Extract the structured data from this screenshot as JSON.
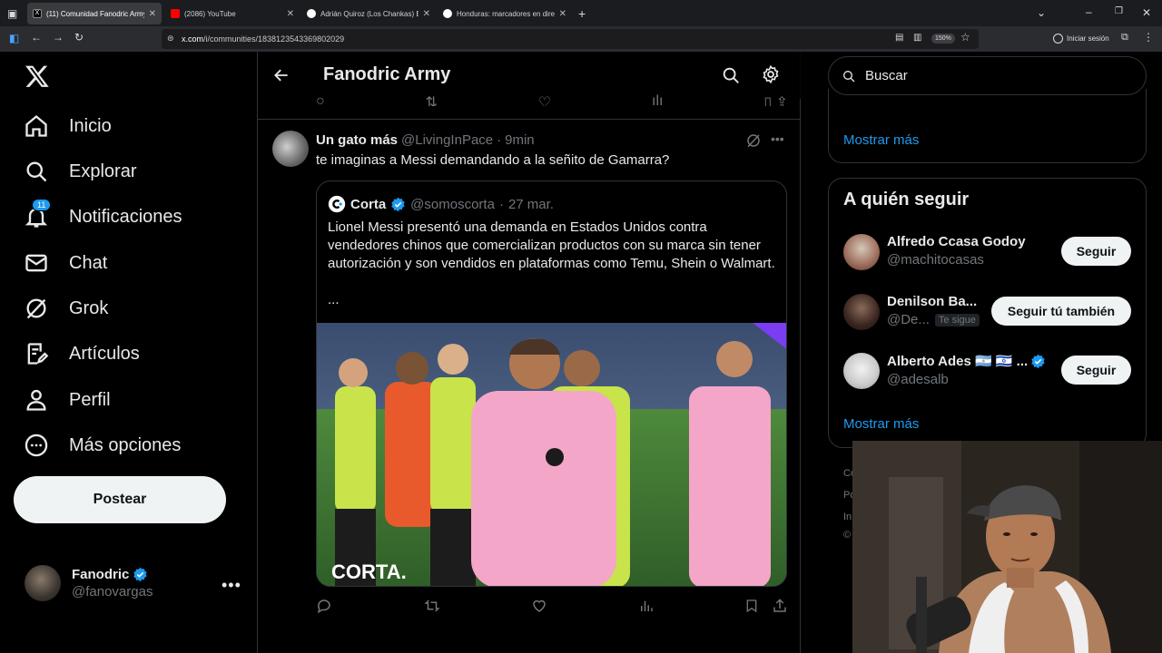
{
  "browser": {
    "tabs": [
      {
        "title": "(11) Comunidad Fanodric Army",
        "active": true
      },
      {
        "title": "(2086) YouTube",
        "active": false
      },
      {
        "title": "Adrián Quiroz (Los Chankas) Est",
        "active": false
      },
      {
        "title": "Honduras: marcadores en direc",
        "active": false
      }
    ],
    "url_host": "x.com",
    "url_path": "/i/communities/1838123543369802029",
    "zoom": "150%",
    "signin": "Iniciar sesión"
  },
  "nav": {
    "items": [
      {
        "label": "Inicio",
        "icon": "home-icon"
      },
      {
        "label": "Explorar",
        "icon": "search-icon"
      },
      {
        "label": "Notificaciones",
        "icon": "bell-icon",
        "badge": "11"
      },
      {
        "label": "Chat",
        "icon": "mail-icon"
      },
      {
        "label": "Grok",
        "icon": "grok-icon"
      },
      {
        "label": "Artículos",
        "icon": "article-icon"
      },
      {
        "label": "Perfil",
        "icon": "person-icon"
      },
      {
        "label": "Más opciones",
        "icon": "more-circle-icon"
      }
    ],
    "post_label": "Postear"
  },
  "account": {
    "name": "Fanodric",
    "handle": "@fanovargas"
  },
  "header": {
    "title": "Fanodric Army"
  },
  "tweet": {
    "name": "Un gato más",
    "handle": "@LivingInPace",
    "time": "9min",
    "text": "te imaginas a Messi demandando a la señito de Gamarra?",
    "quote": {
      "name": "Corta",
      "handle": "@somoscorta",
      "date": "27 mar.",
      "text": "Lionel Messi presentó una demanda en Estados Unidos contra vendedores chinos que comercializan productos con su marca sin tener autorización y son vendidos en plataformas como Temu, Shein o Walmart.",
      "more": "...",
      "watermark": "CORTA."
    }
  },
  "right": {
    "search_placeholder": "Buscar",
    "show_more": "Mostrar más",
    "who_to_follow": "A quién seguir",
    "suggestions": [
      {
        "name": "Alfredo Ccasa Godoy",
        "handle": "@machitocasas",
        "button": "Seguir"
      },
      {
        "name": "Denilson Ba...",
        "handle": "@De...",
        "tag": "Te sigue",
        "button": "Seguir tú también"
      },
      {
        "name": "Alberto Ades 🇦🇷 🇮🇱 ...",
        "handle": "@adesalb",
        "button": "Seguir",
        "verified": true
      }
    ],
    "show_more_2": "Mostrar más",
    "footer_frags": [
      "Co",
      "Po",
      "In",
      "©"
    ]
  },
  "colors": {
    "accent": "#1d9bf0",
    "bg": "#000000",
    "text": "#e7e9ea",
    "muted": "#71767b",
    "border": "#2f3336"
  }
}
